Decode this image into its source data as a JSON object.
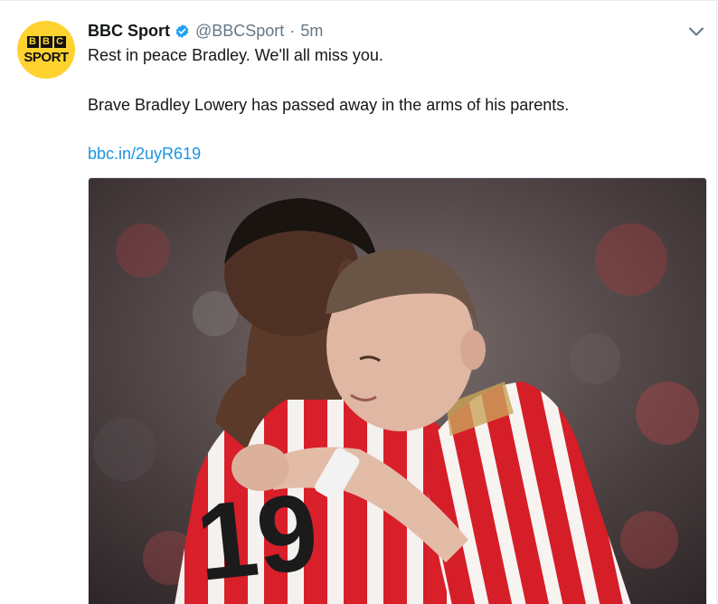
{
  "tweet": {
    "display_name": "BBC Sport",
    "handle": "@BBCSport",
    "separator": "·",
    "time": "5m",
    "line1": "Rest in peace Bradley. We'll all miss you.",
    "line2": "Brave Bradley Lowery has passed away in the arms of his parents.",
    "link": "bbc.in/2uyR619"
  },
  "avatar": {
    "letters": [
      "B",
      "B",
      "C"
    ],
    "word": "SPORT"
  },
  "photo": {
    "shirt_number": "19"
  },
  "icons": {
    "verified": "verified-badge-icon",
    "caret": "chevron-down-icon"
  },
  "colors": {
    "link": "#1b95e0",
    "verified": "#1da1f2",
    "avatar_bg": "#ffd230",
    "muted": "#657786",
    "shirt_red": "#d81f2a"
  }
}
